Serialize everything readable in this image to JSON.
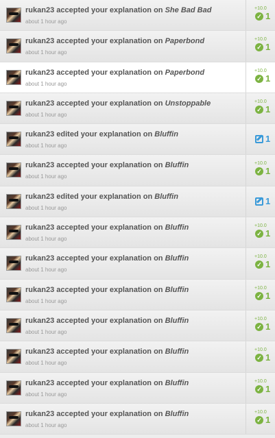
{
  "items": [
    {
      "user": "rukan23",
      "action": "accepted your explanation on",
      "target": "She Bad Bad",
      "time": "about 1 hour ago",
      "type": "accepted",
      "delta": "+10.0",
      "count": "1",
      "highlight": false
    },
    {
      "user": "rukan23",
      "action": "accepted your explanation on",
      "target": "Paperbond",
      "time": "about 1 hour ago",
      "type": "accepted",
      "delta": "+10.0",
      "count": "1",
      "highlight": false
    },
    {
      "user": "rukan23",
      "action": "accepted your explanation on",
      "target": "Paperbond",
      "time": "about 1 hour ago",
      "type": "accepted",
      "delta": "+10.0",
      "count": "1",
      "highlight": true
    },
    {
      "user": "rukan23",
      "action": "accepted your explanation on",
      "target": "Unstoppable",
      "time": "about 1 hour ago",
      "type": "accepted",
      "delta": "+10.0",
      "count": "1",
      "highlight": false
    },
    {
      "user": "rukan23",
      "action": "edited your explanation on",
      "target": "Bluffin",
      "time": "about 1 hour ago",
      "type": "edited",
      "delta": "",
      "count": "1",
      "highlight": false
    },
    {
      "user": "rukan23",
      "action": "accepted your explanation on",
      "target": "Bluffin",
      "time": "about 1 hour ago",
      "type": "accepted",
      "delta": "+10.0",
      "count": "1",
      "highlight": false
    },
    {
      "user": "rukan23",
      "action": "edited your explanation on",
      "target": "Bluffin",
      "time": "about 1 hour ago",
      "type": "edited",
      "delta": "",
      "count": "1",
      "highlight": false
    },
    {
      "user": "rukan23",
      "action": "accepted your explanation on",
      "target": "Bluffin",
      "time": "about 1 hour ago",
      "type": "accepted",
      "delta": "+10.0",
      "count": "1",
      "highlight": false
    },
    {
      "user": "rukan23",
      "action": "accepted your explanation on",
      "target": "Bluffin",
      "time": "about 1 hour ago",
      "type": "accepted",
      "delta": "+10.0",
      "count": "1",
      "highlight": false
    },
    {
      "user": "rukan23",
      "action": "accepted your explanation on",
      "target": "Bluffin",
      "time": "about 1 hour ago",
      "type": "accepted",
      "delta": "+10.0",
      "count": "1",
      "highlight": false
    },
    {
      "user": "rukan23",
      "action": "accepted your explanation on",
      "target": "Bluffin",
      "time": "about 1 hour ago",
      "type": "accepted",
      "delta": "+10.0",
      "count": "1",
      "highlight": false
    },
    {
      "user": "rukan23",
      "action": "accepted your explanation on",
      "target": "Bluffin",
      "time": "about 1 hour ago",
      "type": "accepted",
      "delta": "+10.0",
      "count": "1",
      "highlight": false
    },
    {
      "user": "rukan23",
      "action": "accepted your explanation on",
      "target": "Bluffin",
      "time": "about 1 hour ago",
      "type": "accepted",
      "delta": "+10.0",
      "count": "1",
      "highlight": false
    },
    {
      "user": "rukan23",
      "action": "accepted your explanation on",
      "target": "Bluffin",
      "time": "about 1 hour ago",
      "type": "accepted",
      "delta": "+10.0",
      "count": "1",
      "highlight": false
    }
  ],
  "icons": {
    "accepted": "check-circle-icon",
    "edited": "edit-icon"
  },
  "colors": {
    "accepted": "#7cb342",
    "edited": "#3a9ad9",
    "row_bg": "#ededed",
    "highlight_bg": "#ffffff"
  }
}
